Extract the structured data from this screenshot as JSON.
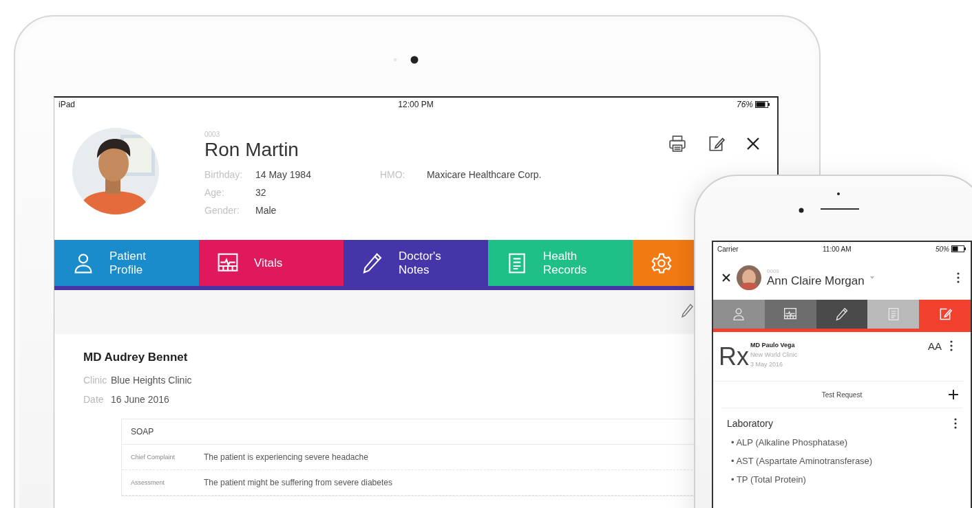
{
  "tablet": {
    "status_bar": {
      "device": "iPad",
      "time": "12:00 PM",
      "battery": "76%"
    },
    "patient": {
      "code": "0003",
      "name": "Ron Martin",
      "fields": [
        {
          "label": "Birthday:",
          "value": "14 May 1984"
        },
        {
          "label": "Age:",
          "value": "32"
        },
        {
          "label": "Gender:",
          "value": "Male"
        }
      ],
      "hmo": {
        "label": "HMO:",
        "value": "Maxicare Healthcare Corp."
      }
    },
    "tabs": [
      {
        "label": "Patient\nProfile",
        "color": "#1a8ccb",
        "selected": false
      },
      {
        "label": "Vitals",
        "color": "#e0185c",
        "selected": false
      },
      {
        "label": "Doctor's\nNotes",
        "color": "#4435a8",
        "selected": true
      },
      {
        "label": "Health\nRecords",
        "color": "#1fbf88",
        "selected": false
      },
      {
        "color": "#f27a12",
        "selected": false
      }
    ],
    "note": {
      "doctor": "MD Audrey Bennet",
      "fields": [
        {
          "label": "Clinic",
          "value": "Blue Heights Clinic"
        },
        {
          "label": "Date",
          "value": "16 June 2016"
        }
      ],
      "soap": {
        "title": "SOAP",
        "rows": [
          {
            "label": "Chief Complaint",
            "value": "The patient is experiencing severe headache"
          },
          {
            "label": "Assessment",
            "value": "The patient might be suffering from severe diabetes"
          }
        ]
      }
    }
  },
  "phone": {
    "status_bar": {
      "carrier": "Carrier",
      "time": "11:00 AM",
      "battery": "50%"
    },
    "patient": {
      "code": "0009",
      "name": "Ann Claire Morgan"
    },
    "tabs": [
      {
        "color": "#8f8f8f",
        "selected": false
      },
      {
        "color": "#6d6d6d",
        "selected": false
      },
      {
        "color": "#4a4a4a",
        "selected": false
      },
      {
        "color": "#b9b9b9",
        "selected": false
      },
      {
        "color": "#f2402f",
        "selected": true
      }
    ],
    "prescription": {
      "symbol": "Rx",
      "doctor": "MD Paulo Vega",
      "clinic": "New World Clinic",
      "date": "3 May 2016",
      "text_size": "AA"
    },
    "test_request": "Test Request",
    "section": {
      "title": "Laboratory",
      "items": [
        "• ALP (Alkaline Phosphatase)",
        "• AST (Aspartate Aminotransferase)",
        "• TP (Total Protein)"
      ]
    }
  }
}
